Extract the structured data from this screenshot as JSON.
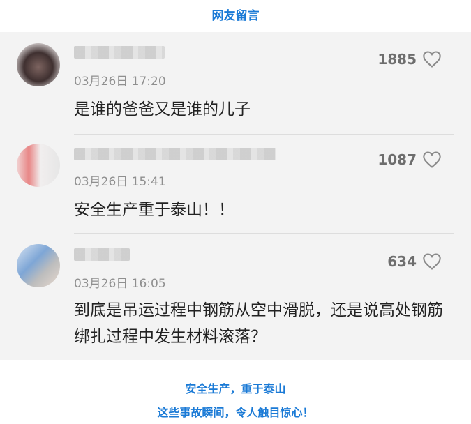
{
  "header": {
    "title": "网友留言"
  },
  "comments": [
    {
      "timestamp": "03月26日 17:20",
      "likes": "1885",
      "text": "是谁的爸爸又是谁的儿子"
    },
    {
      "timestamp": "03月26日 15:41",
      "likes": "1087",
      "text": "安全生产重于泰山！！"
    },
    {
      "timestamp": "03月26日 16:05",
      "likes": "634",
      "text": "到底是吊运过程中钢筋从空中滑脱，还是说高处钢筋绑扎过程中发生材料滚落？"
    }
  ],
  "footer": {
    "line1": "安全生产，重于泰山",
    "line2": "这些事故瞬间，令人触目惊心！"
  },
  "colors": {
    "accent": "#1a7ad6",
    "panel_bg": "#f3f3f3"
  },
  "icons": {
    "like": "heart-outline-icon",
    "avatar": "blurred-avatar",
    "username": "blurred-username"
  }
}
